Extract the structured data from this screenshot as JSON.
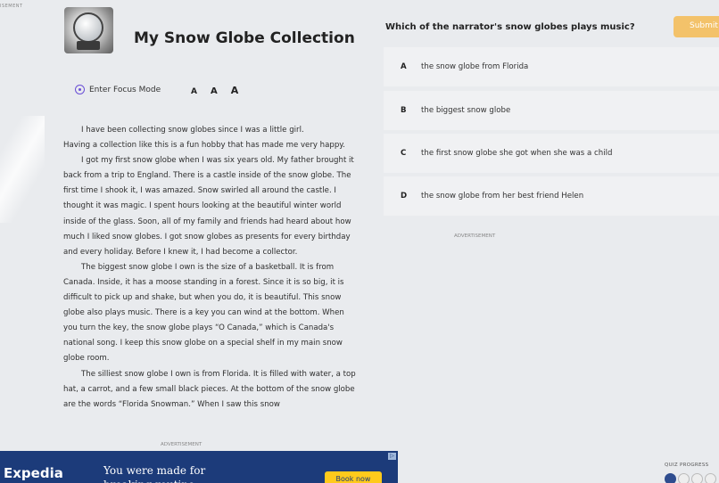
{
  "ads": {
    "top_label": "ISEMENT",
    "right_label": "ADVERTISEMENT",
    "bottom_label": "ADVERTISEMENT",
    "banner": {
      "brand": "Expedia",
      "text": "You were made for breaking routine",
      "cta": "Book now"
    }
  },
  "story": {
    "title": "My Snow Globe Collection",
    "focus_mode_label": "Enter Focus Mode",
    "font_size_options": [
      "A",
      "A",
      "A"
    ],
    "first_line": "I have been collecting snow globes since I was a little girl.",
    "paragraphs": [
      "Having a collection like this is a fun hobby that has made me very happy.",
      "I got my first snow globe when I was six years old. My father brought it back from a trip to England. There is a castle inside of the snow globe. The first time I shook it, I was amazed. Snow swirled all around the castle. I thought it was magic. I spent hours looking at the beautiful winter world inside of the glass. Soon, all of my family and friends had heard about how much I liked snow globes. I got snow globes as presents for every birthday and every holiday. Before I knew it, I had become a collector.",
      "The biggest snow globe I own is the size of a basketball. It is from Canada. Inside, it has a moose standing in a forest. Since it is so big, it is difficult to pick up and shake, but when you do, it is beautiful. This snow globe also plays music. There is a key you can wind at the bottom. When you turn the key, the snow globe plays “O Canada,” which is Canada's national song. I keep this snow globe on a special shelf in my main snow globe room.",
      "The silliest snow globe I own is from Florida. It is filled with water, a top hat, a carrot, and a few small black pieces. At the bottom of the snow globe are the words “Florida Snowman.” When I saw this snow"
    ]
  },
  "quiz": {
    "question": "Which of the narrator's snow globes plays music?",
    "submit_label": "Submit",
    "options": [
      {
        "letter": "A",
        "text": "the snow globe from Florida"
      },
      {
        "letter": "B",
        "text": "the biggest snow globe"
      },
      {
        "letter": "C",
        "text": "the first snow globe she got when she was a child"
      },
      {
        "letter": "D",
        "text": "the snow globe from her best friend Helen"
      }
    ],
    "progress_label": "QUIZ PROGRESS",
    "progress_answered": 1,
    "progress_total": 4
  }
}
